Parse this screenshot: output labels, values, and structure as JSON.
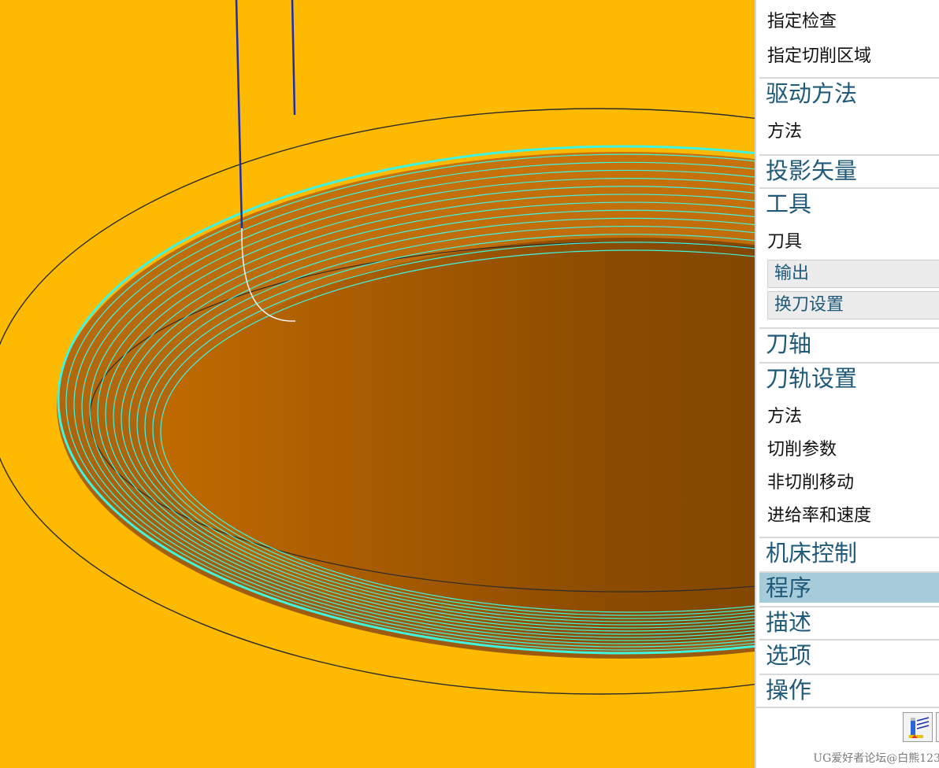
{
  "panel": {
    "items": [
      {
        "label": "指定检查",
        "kind": "sub"
      },
      {
        "label": "指定切削区域",
        "kind": "sub"
      },
      {
        "label": "驱动方法",
        "kind": "section"
      },
      {
        "label": "方法",
        "kind": "sub"
      },
      {
        "label": "投影矢量",
        "kind": "section"
      },
      {
        "label": "工具",
        "kind": "section"
      },
      {
        "label": "刀具",
        "kind": "sub"
      },
      {
        "label": "输出",
        "kind": "button"
      },
      {
        "label": "换刀设置",
        "kind": "button"
      },
      {
        "label": "刀轴",
        "kind": "section"
      },
      {
        "label": "刀轨设置",
        "kind": "section"
      },
      {
        "label": "方法",
        "kind": "sub"
      },
      {
        "label": "切削参数",
        "kind": "sub"
      },
      {
        "label": "非切削移动",
        "kind": "sub"
      },
      {
        "label": "进给率和速度",
        "kind": "sub"
      },
      {
        "label": "机床控制",
        "kind": "section"
      },
      {
        "label": "程序",
        "kind": "section",
        "selected": true
      },
      {
        "label": "描述",
        "kind": "section"
      },
      {
        "label": "选项",
        "kind": "section"
      },
      {
        "label": "操作",
        "kind": "section"
      }
    ],
    "action_icon": "generate-toolpath-icon"
  },
  "watermark": "UG爱好者论坛@白熊123",
  "colors": {
    "background": "#fdba00",
    "toolpath": "#3ff5e0",
    "tool_axis": "#1a2db3",
    "section_text": "#1f5a7a",
    "selected_row": "#a6ccd9"
  }
}
